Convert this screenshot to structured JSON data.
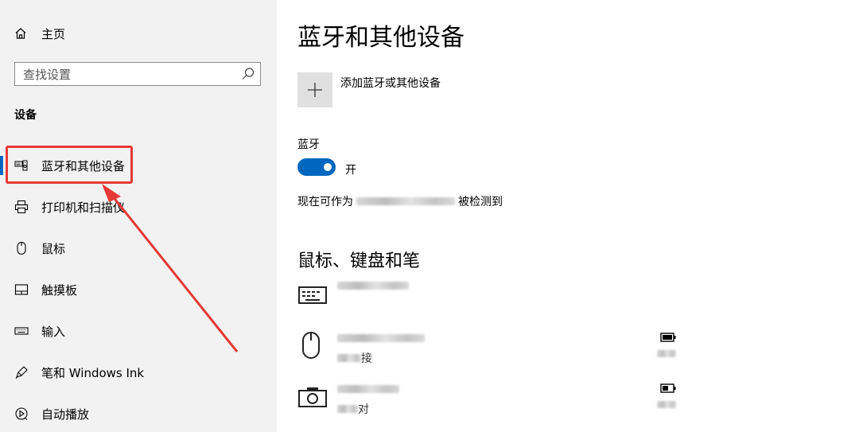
{
  "sidebar": {
    "home_label": "主页",
    "search_placeholder": "查找设置",
    "section_label": "设备",
    "items": [
      {
        "label": "蓝牙和其他设备",
        "icon": "bluetooth-devices-icon",
        "active": true
      },
      {
        "label": "打印机和扫描仪",
        "icon": "printer-icon"
      },
      {
        "label": "鼠标",
        "icon": "mouse-icon"
      },
      {
        "label": "触摸板",
        "icon": "touchpad-icon"
      },
      {
        "label": "输入",
        "icon": "keyboard-icon"
      },
      {
        "label": "笔和 Windows Ink",
        "icon": "pen-icon"
      },
      {
        "label": "自动播放",
        "icon": "autoplay-icon"
      }
    ]
  },
  "main": {
    "title": "蓝牙和其他设备",
    "add_device_label": "添加蓝牙或其他设备",
    "bluetooth": {
      "label": "蓝牙",
      "toggle_state": "开",
      "discoverable_prefix": "现在可作为",
      "discoverable_suffix": "被检测到"
    },
    "peripherals_title": "鼠标、键盘和笔",
    "devices": [
      {
        "icon": "keyboard-device-icon",
        "status_suffix": ""
      },
      {
        "icon": "mouse-device-icon",
        "status_suffix": "接"
      },
      {
        "icon": "camera-device-icon",
        "status_suffix": "对"
      }
    ]
  },
  "colors": {
    "accent": "#0067c0",
    "annotation": "#e53935"
  }
}
